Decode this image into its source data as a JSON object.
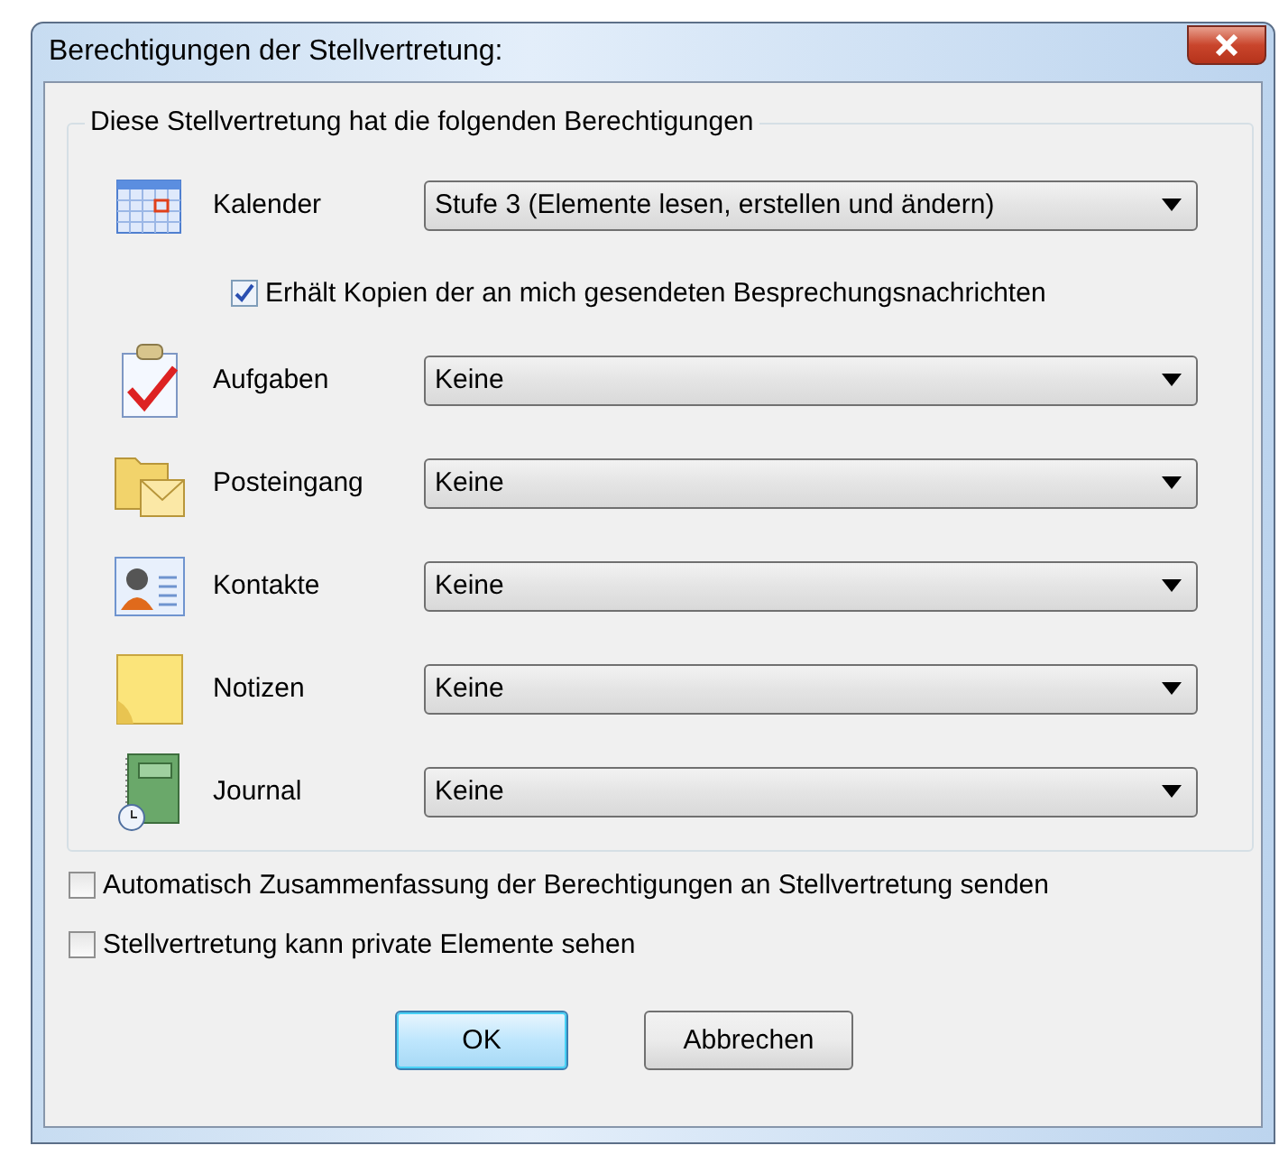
{
  "window": {
    "title": "Berechtigungen der Stellvertretung:"
  },
  "group": {
    "title": "Diese Stellvertretung hat die folgenden Berechtigungen",
    "rows": [
      {
        "kind": "calendar",
        "label": "Kalender",
        "value": "Stufe 3 (Elemente lesen, erstellen und ändern)",
        "option": {
          "label": "Erhält Kopien der an mich gesendeten Besprechungsnachrichten",
          "checked": true
        }
      },
      {
        "kind": "tasks",
        "label": "Aufgaben",
        "value": "Keine"
      },
      {
        "kind": "inbox",
        "label": "Posteingang",
        "value": "Keine"
      },
      {
        "kind": "contacts",
        "label": "Kontakte",
        "value": "Keine"
      },
      {
        "kind": "notes",
        "label": "Notizen",
        "value": "Keine"
      },
      {
        "kind": "journal",
        "label": "Journal",
        "value": "Keine"
      }
    ]
  },
  "options": [
    {
      "label": "Automatisch Zusammenfassung der Berechtigungen an Stellvertretung senden",
      "checked": false
    },
    {
      "label": "Stellvertretung kann private Elemente sehen",
      "checked": false
    }
  ],
  "buttons": [
    {
      "label": "OK",
      "default": true
    },
    {
      "label": "Abbrechen",
      "default": false
    }
  ]
}
